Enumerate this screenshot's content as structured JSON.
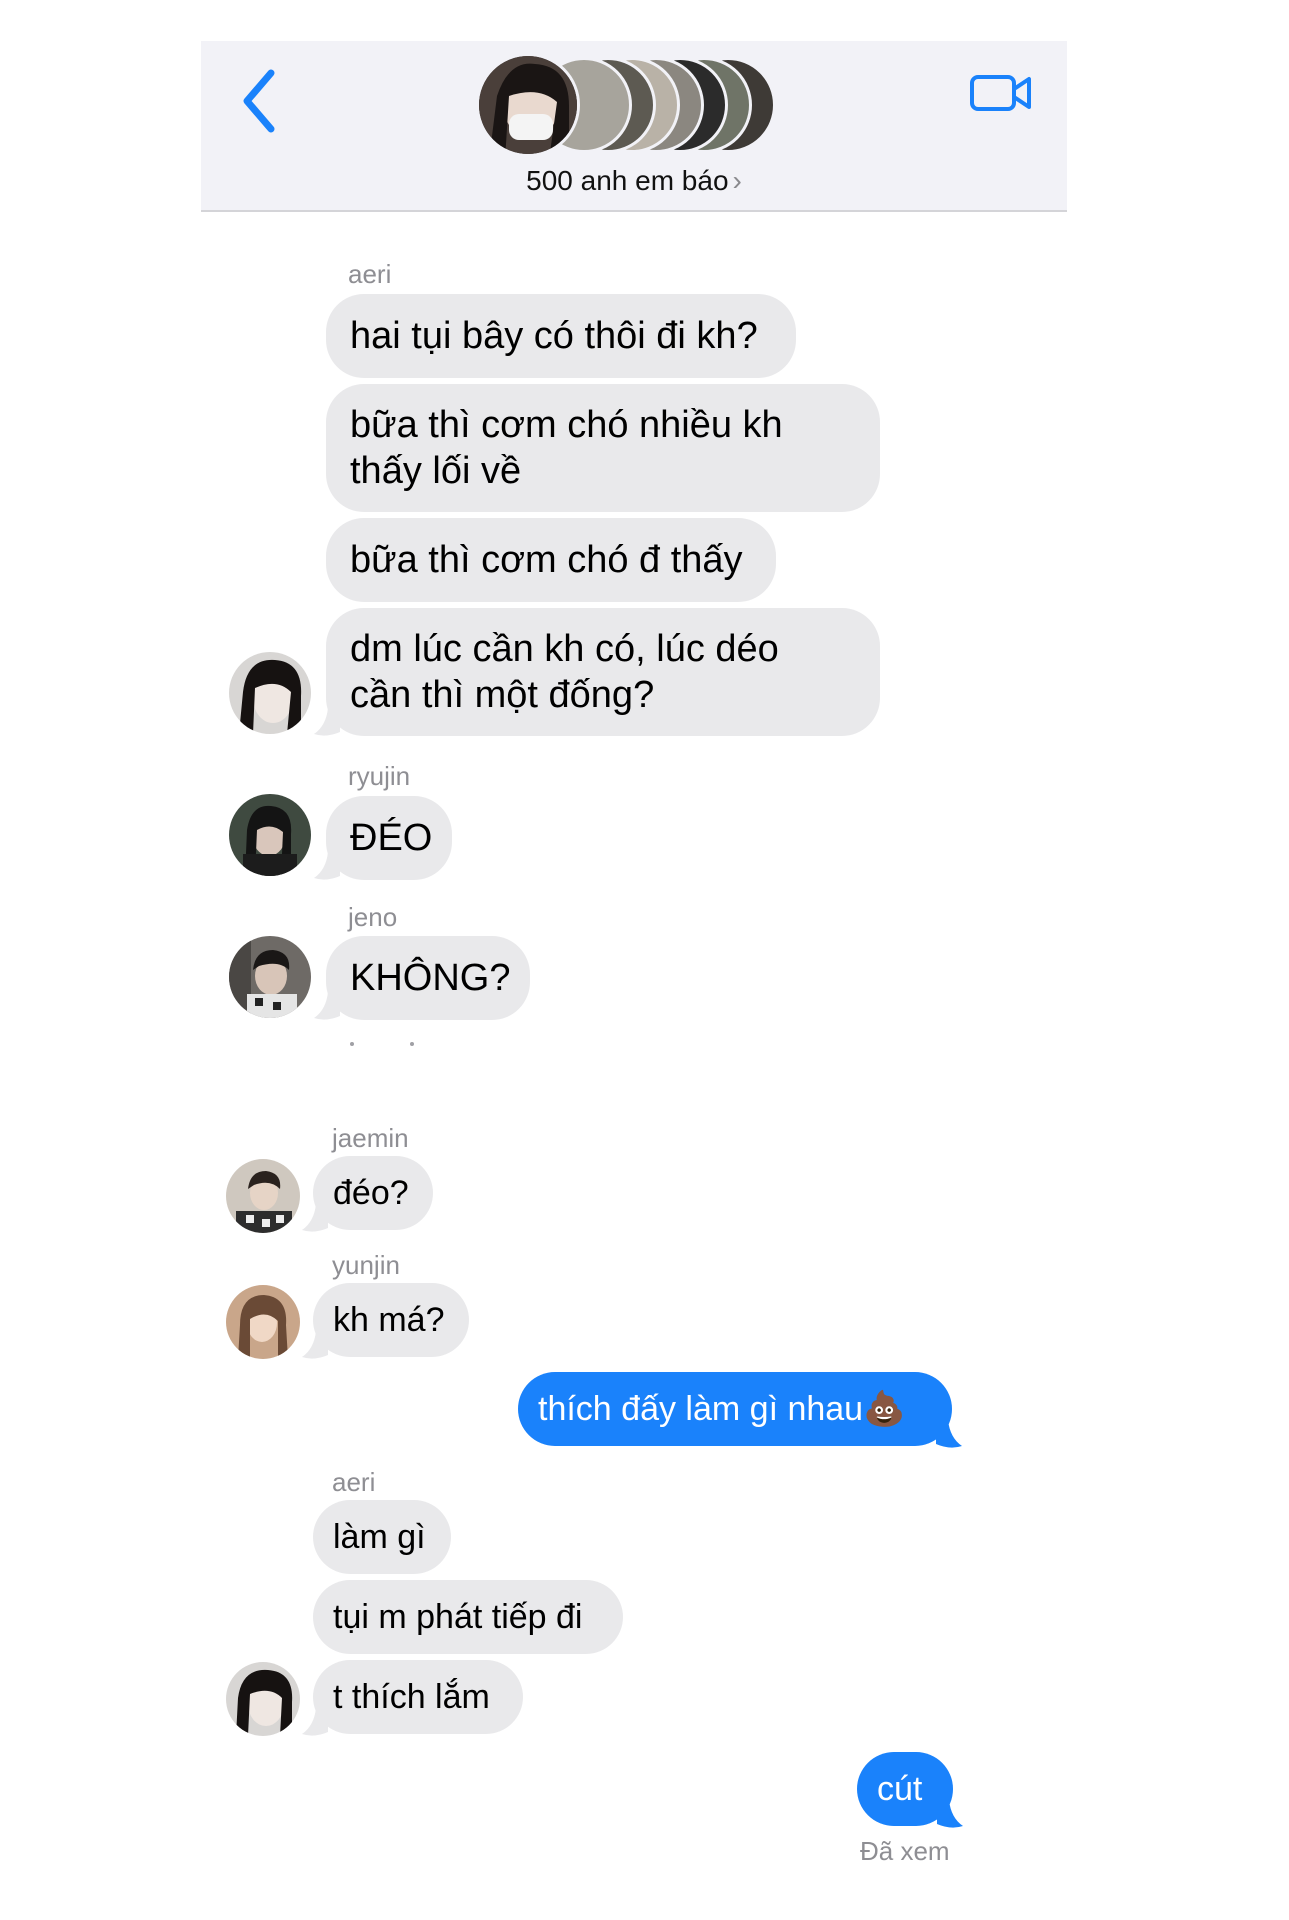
{
  "header": {
    "group_name": "500 anh em báo",
    "chevron": "›",
    "back_icon": "chevron-left-icon",
    "video_icon": "video-camera-icon",
    "accent": "#1a82fb",
    "background": "#f2f2f7"
  },
  "messages": [
    {
      "sender": "aeri",
      "bubbles": [
        "hai tụi bây có thôi đi kh?",
        "bữa thì cơm chó nhiều kh\nthấy lối về",
        "bữa thì cơm chó đ thấy",
        "dm lúc cần kh có, lúc déo\ncần thì một đống?"
      ]
    },
    {
      "sender": "ryujin",
      "bubbles": [
        "ĐÉO"
      ]
    },
    {
      "sender": "jeno",
      "bubbles": [
        "KHÔNG?"
      ]
    },
    {
      "sender": "jaemin",
      "bubbles": [
        "đéo?"
      ]
    },
    {
      "sender": "yunjin",
      "bubbles": [
        "kh má?"
      ]
    },
    {
      "outgoing": "thích đấy làm gì nhau💩"
    },
    {
      "sender": "aeri",
      "bubbles": [
        "làm gì",
        "tụi m phát tiếp đi",
        "t thích lắm"
      ]
    },
    {
      "outgoing": "cút"
    }
  ],
  "read_receipt": "Đã xem",
  "colors": {
    "incoming_bubble": "#e9e9eb",
    "outgoing_bubble": "#1a82fb",
    "sender_label": "#8e8e93"
  }
}
